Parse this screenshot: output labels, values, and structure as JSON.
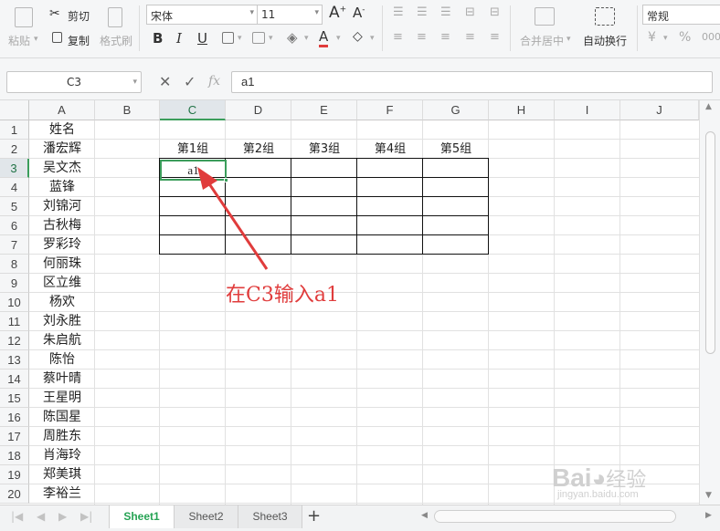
{
  "ribbon": {
    "paste": "粘贴",
    "cut": "剪切",
    "copy": "复制",
    "format_painter": "格式刷",
    "font_name": "宋体",
    "font_size": "11",
    "bold": "B",
    "italic": "I",
    "underline": "U",
    "font_color_glyph": "A",
    "merge_center": "合并居中",
    "wrap_text": "自动换行",
    "number_format": "常规",
    "currency_glyph": "¥",
    "percent_glyph": "%",
    "thousands_glyph": "000"
  },
  "formula_bar": {
    "name_box": "C3",
    "fx": "fx",
    "content": "a1"
  },
  "columns": [
    "A",
    "B",
    "C",
    "D",
    "E",
    "F",
    "G",
    "H",
    "I",
    "J"
  ],
  "rows": [
    "1",
    "2",
    "3",
    "4",
    "5",
    "6",
    "7",
    "8",
    "9",
    "10",
    "11",
    "12",
    "13",
    "14",
    "15",
    "16",
    "17",
    "18",
    "19",
    "20"
  ],
  "column_a": [
    "姓名",
    "潘宏辉",
    "吴文杰",
    "蓝锋",
    "刘锦河",
    "古秋梅",
    "罗彩玲",
    "何丽珠",
    "区立维",
    "杨欢",
    "刘永胜",
    "朱启航",
    "陈怡",
    "蔡叶晴",
    "王星明",
    "陈国星",
    "周胜东",
    "肖海玲",
    "郑美琪",
    "李裕兰"
  ],
  "table_headers": [
    "第1组",
    "第2组",
    "第3组",
    "第4组",
    "第5组"
  ],
  "active_cell_value": "a1",
  "annotation": "在C3输入a1",
  "sheets": [
    "Sheet1",
    "Sheet2",
    "Sheet3"
  ],
  "add_sheet": "+",
  "watermark": {
    "brand": "Bai",
    "brand2": "经验",
    "url": "jingyan.baidu.com"
  },
  "colors": {
    "accent": "#3b9d5b",
    "annotation": "#e03c3c"
  }
}
